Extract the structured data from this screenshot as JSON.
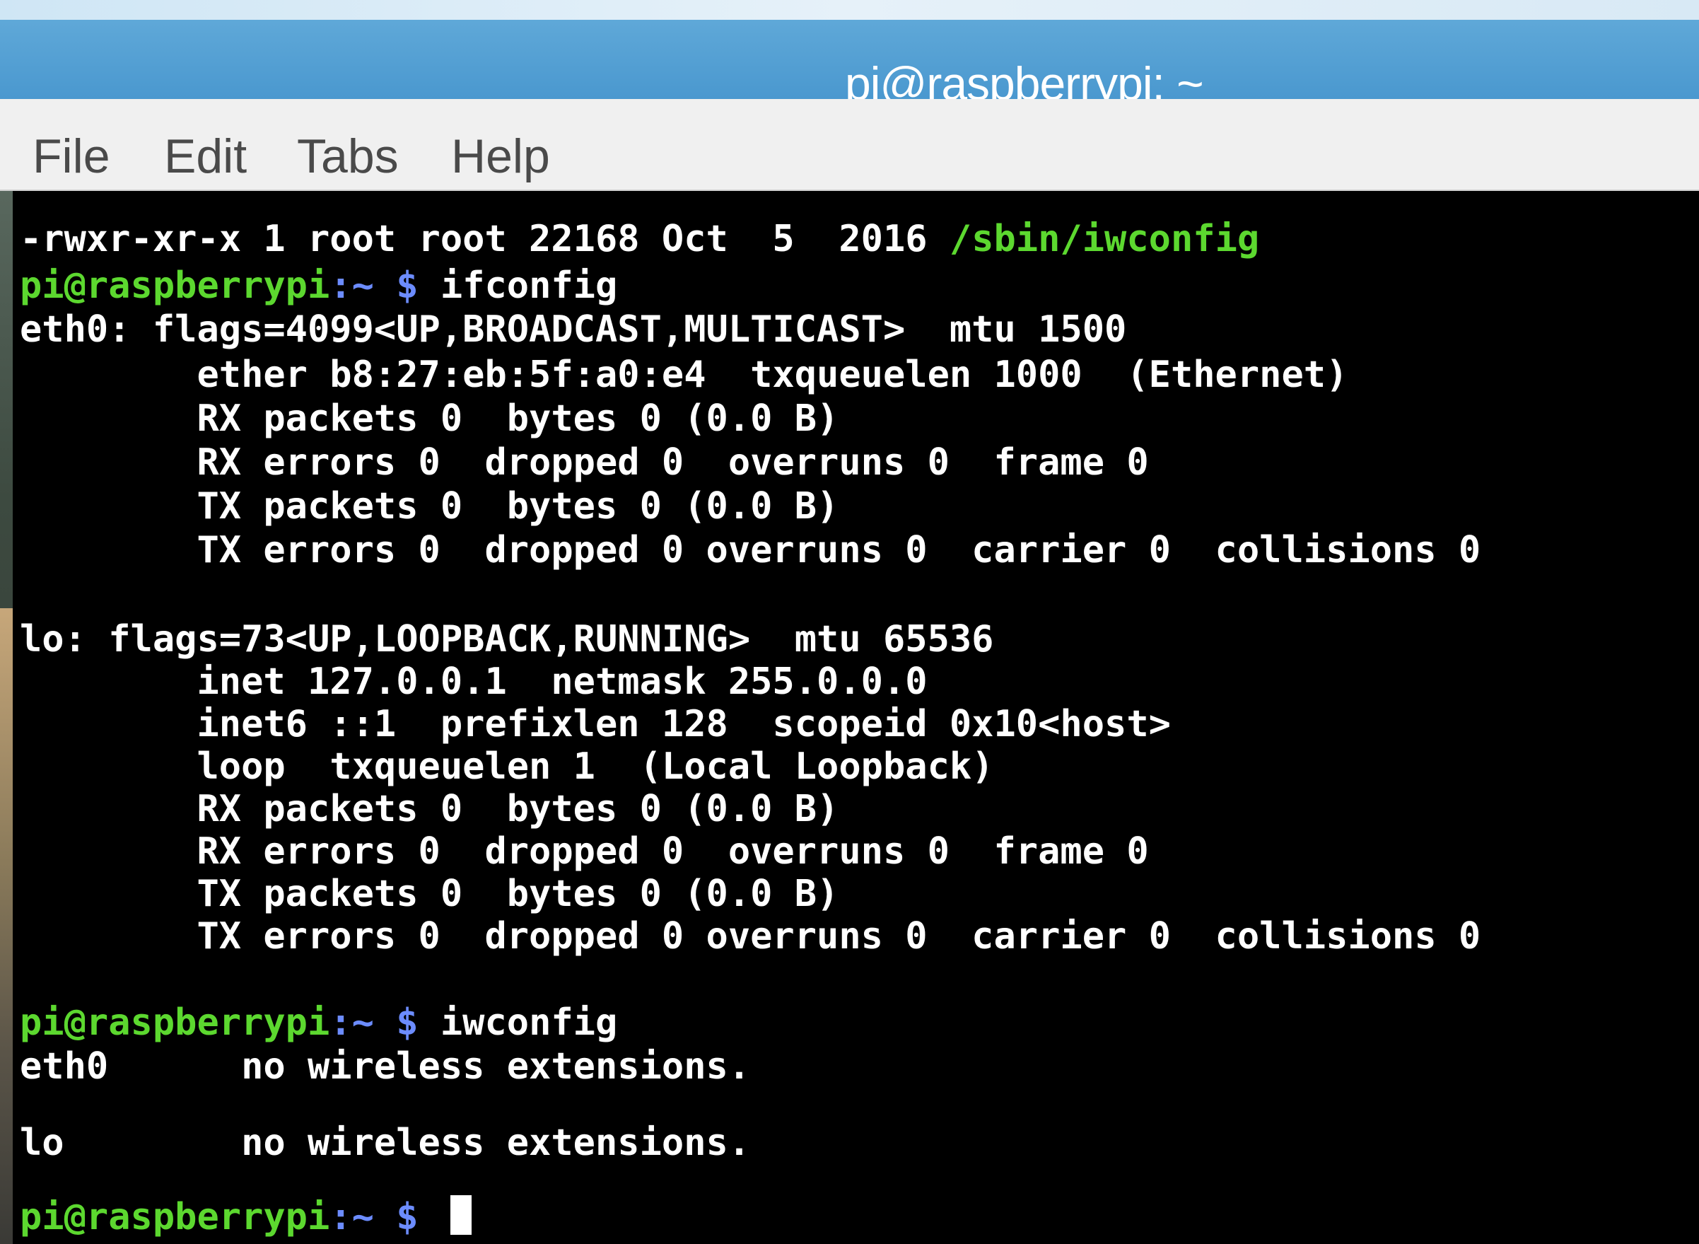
{
  "window": {
    "title": "pi@raspberrypi: ~"
  },
  "menu": {
    "items": [
      "File",
      "Edit",
      "Tabs",
      "Help"
    ]
  },
  "terminal": {
    "prompt_user": "pi@raspberrypi",
    "prompt_path": ":~ $",
    "lines": {
      "l0_prefix": "-rwxr-xr-x 1 root root 22168 Oct  5  2016 ",
      "l0_path": "/sbin/iwconfig",
      "l1_cmd": " ifconfig",
      "l2": "eth0: flags=4099<UP,BROADCAST,MULTICAST>  mtu 1500",
      "l3": "        ether b8:27:eb:5f:a0:e4  txqueuelen 1000  (Ethernet)",
      "l4": "        RX packets 0  bytes 0 (0.0 B)",
      "l5": "        RX errors 0  dropped 0  overruns 0  frame 0",
      "l6": "        TX packets 0  bytes 0 (0.0 B)",
      "l7": "        TX errors 0  dropped 0 overruns 0  carrier 0  collisions 0",
      "l8": "lo: flags=73<UP,LOOPBACK,RUNNING>  mtu 65536",
      "l9": "        inet 127.0.0.1  netmask 255.0.0.0",
      "l10": "        inet6 ::1  prefixlen 128  scopeid 0x10<host>",
      "l11": "        loop  txqueuelen 1  (Local Loopback)",
      "l12": "        RX packets 0  bytes 0 (0.0 B)",
      "l13": "        RX errors 0  dropped 0  overruns 0  frame 0",
      "l14": "        TX packets 0  bytes 0 (0.0 B)",
      "l15": "        TX errors 0  dropped 0 overruns 0  carrier 0  collisions 0",
      "l16_cmd": " iwconfig",
      "l17": "eth0      no wireless extensions.",
      "l18": "lo        no wireless extensions.",
      "l19_cmd": " "
    }
  },
  "colors": {
    "prompt_green": "#5cd82f",
    "prompt_blue": "#6c8cff",
    "terminal_bg": "#000000",
    "titlebar_blue": "#4a98cf"
  }
}
